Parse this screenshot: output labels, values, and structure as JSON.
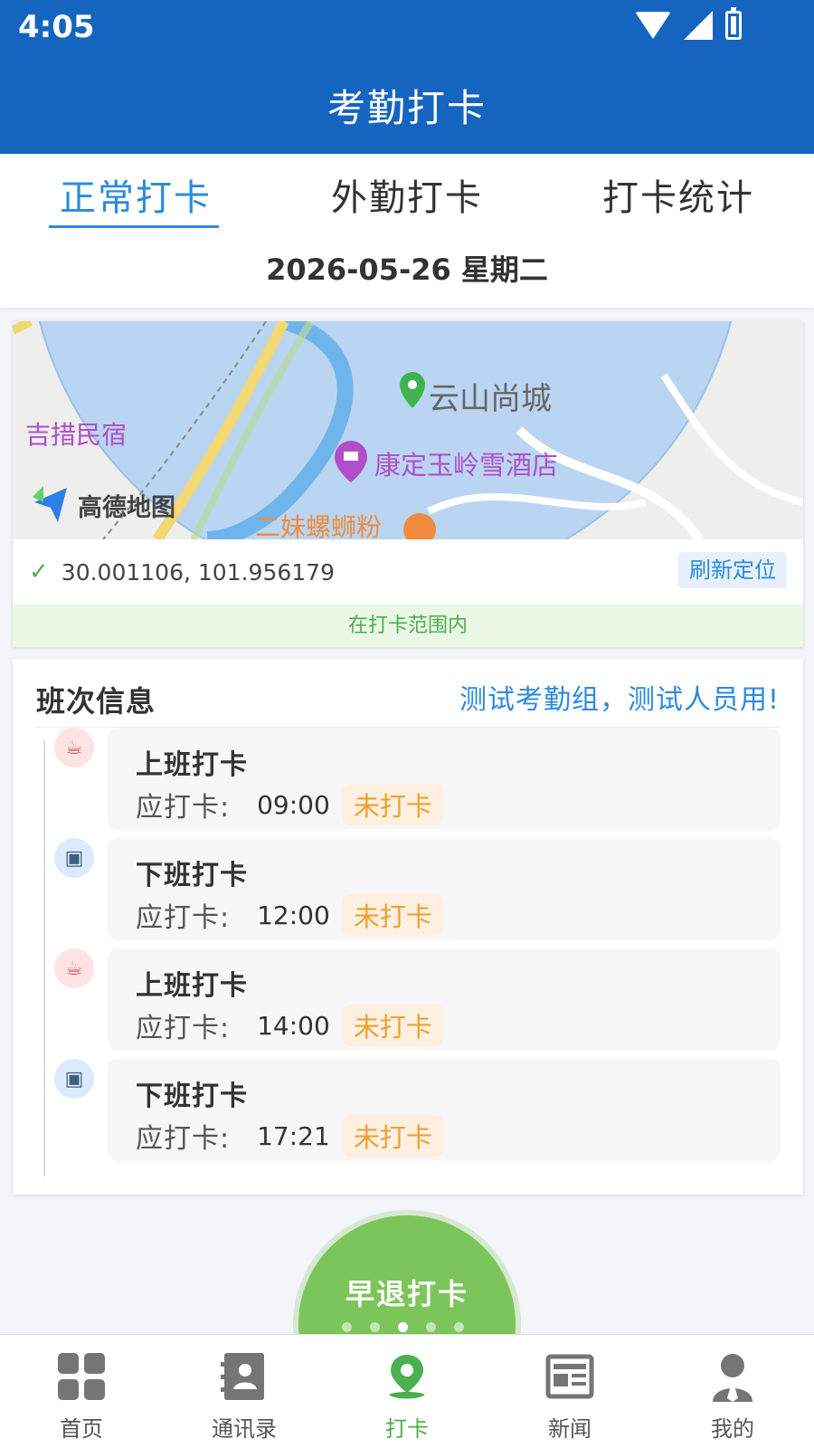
{
  "status_bar": {
    "time": "4:05"
  },
  "app_title": "考勤打卡",
  "tabs": [
    {
      "label": "正常打卡",
      "active": true
    },
    {
      "label": "外勤打卡",
      "active": false
    },
    {
      "label": "打卡统计",
      "active": false
    }
  ],
  "date_text": "2026-05-26 星期二",
  "map": {
    "labels": {
      "place1": "云山尚城",
      "place2": "吉措民宿",
      "place3": "康定玉岭雪酒店",
      "place4": "二妹螺蛳粉",
      "provider": "高德地图"
    },
    "coordinates": "30.001106, 101.956179",
    "refresh_label": "刷新定位",
    "range_status": "在打卡范围内"
  },
  "shift": {
    "title": "班次信息",
    "group_text": "测试考勤组，测试人员用!",
    "items": [
      {
        "name": "上班打卡",
        "label": "应打卡:",
        "time": "09:00",
        "status": "未打卡",
        "icon": "coffee-icon"
      },
      {
        "name": "下班打卡",
        "label": "应打卡:",
        "time": "12:00",
        "status": "未打卡",
        "icon": "briefcase-icon"
      },
      {
        "name": "上班打卡",
        "label": "应打卡:",
        "time": "14:00",
        "status": "未打卡",
        "icon": "coffee-icon"
      },
      {
        "name": "下班打卡",
        "label": "应打卡:",
        "time": "17:21",
        "status": "未打卡",
        "icon": "briefcase-icon"
      }
    ]
  },
  "punch_button": {
    "label": "早退打卡"
  },
  "bottom_nav": [
    {
      "label": "首页",
      "icon": "grid-icon",
      "active": false
    },
    {
      "label": "通讯录",
      "icon": "contacts-icon",
      "active": false
    },
    {
      "label": "打卡",
      "icon": "location-pin-icon",
      "active": true
    },
    {
      "label": "新闻",
      "icon": "news-icon",
      "active": false
    },
    {
      "label": "我的",
      "icon": "user-icon",
      "active": false
    }
  ],
  "colors": {
    "primary": "#1565c0",
    "accent": "#2b8ae0",
    "success": "#4caf50",
    "warning": "#f0a030"
  }
}
